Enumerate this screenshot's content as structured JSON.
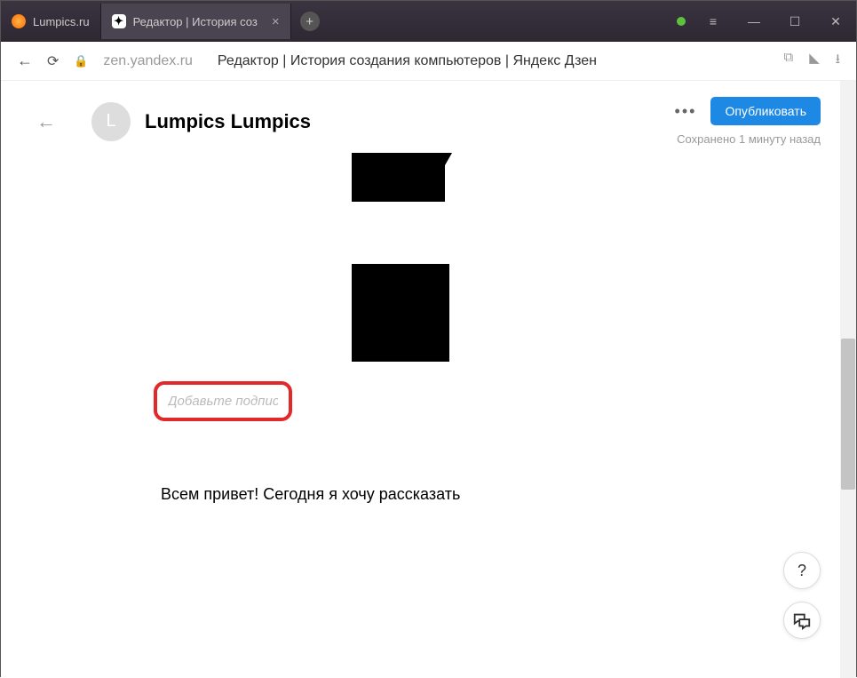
{
  "tabs": [
    {
      "title": "Lumpics.ru"
    },
    {
      "title": "Редактор | История соз"
    }
  ],
  "address": {
    "domain": "zen.yandex.ru",
    "title": "Редактор | История создания компьютеров | Яндекс Дзен"
  },
  "editor": {
    "avatar_letter": "L",
    "channel": "Lumpics Lumpics",
    "more_label": "•••",
    "publish_label": "Опубликовать",
    "save_status": "Сохранено 1 минуту назад",
    "caption_placeholder": "Добавьте подпись",
    "body_text": "Всем привет! Сегодня я хочу рассказать",
    "help_label": "?",
    "newtab_label": "+",
    "close_label": "×"
  }
}
